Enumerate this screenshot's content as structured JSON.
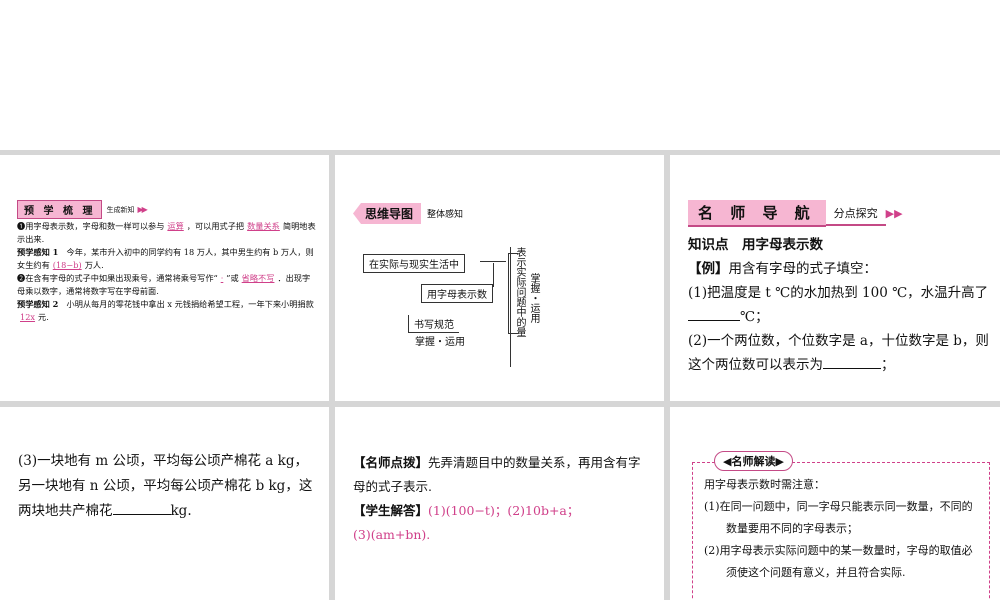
{
  "panel1": {
    "title": "预 学 梳 理",
    "subtitle": "生成新知",
    "arrow": "▶▶",
    "lines": [
      {
        "pre": "❶用字母表示数，字母和数一样可以参与",
        "a1": "运算",
        "mid": "，可以用式子把",
        "a2": "数量关系",
        "post": "简明地表示出来."
      },
      {
        "label": "预学感知 1",
        "text": "今年，某市升入初中的同学约有 18 万人，其中男生约有 b 万人，则女生约有",
        "ans": "(18−b)",
        "post": "万人."
      },
      {
        "pre": "❷在含有字母的式子中如果出现乘号，通常将乘号写作“",
        "a1": "·",
        "mid": "”或",
        "a2": "省略不写",
        "post": "．出现字母乘以数字，通常将数字写在字母前面."
      },
      {
        "label": "预学感知 2",
        "text": "小明从每月的零花钱中拿出 x 元钱捐给希望工程，一年下来小明捐款",
        "ans": "12x",
        "post": "元."
      }
    ]
  },
  "panel2": {
    "title": "思维导图",
    "subtitle": "整体感知",
    "box1": "在实际与现实生活中",
    "box2": "用字母表示数",
    "box3": "书写规范",
    "caption": "掌握・运用",
    "vert1": "表示实际问题中的量",
    "vert2": "掌握・运用"
  },
  "panel3": {
    "title": "名 师 导 航",
    "subtitle": "分点探究",
    "arrow": "▶▶",
    "point": "知识点　用字母表示数",
    "example_label": "【例】",
    "example": "用含有字母的式子填空：",
    "q1a": "(1)把温度是 t ℃的水加热到 100 ℃，水温升高了",
    "q1b": "℃；",
    "q2": "(2)一个两位数，个位数字是 a，十位数字是 b，则这个两位数可以表示为",
    "q2b": "；"
  },
  "panel4": {
    "q3": "(3)一块地有 m 公顷，平均每公顷产棉花 a kg，另一块地有 n 公顷，平均每公顷产棉花 b kg，这两块地共产棉花",
    "q3b": "kg."
  },
  "panel5": {
    "tip_label": "【名师点拨】",
    "tip": "先弄清题目中的数量关系，再用含有字母的式子表示.",
    "ans_label": "【学生解答】",
    "ans1": "(1)(100−t)；(2)10b+a；",
    "ans2": "(3)(am+bn)."
  },
  "panel6": {
    "tag": "◀名师解读▶",
    "intro": "用字母表示数时需注意：",
    "items": [
      "(1)在同一问题中，同一字母只能表示同一数量，不同的数量要用不同的字母表示；",
      "(2)用字母表示实际问题中的某一数量时，字母的取值必须使这个问题有意义，并且符合实际."
    ]
  }
}
